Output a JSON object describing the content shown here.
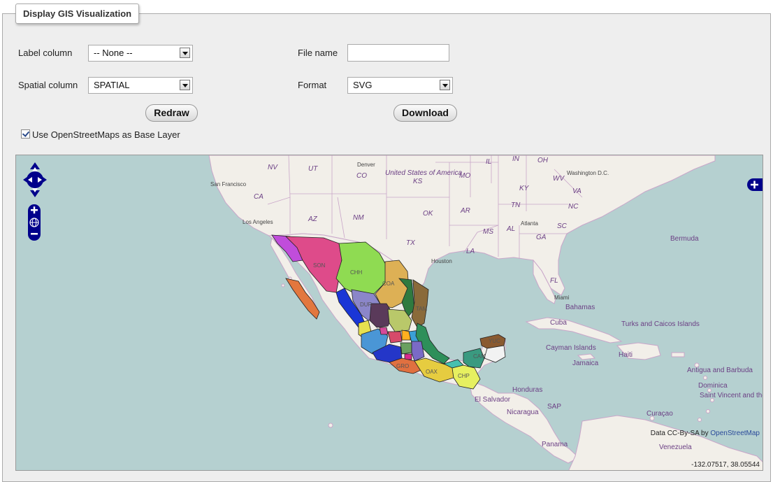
{
  "panel": {
    "title": "Display GIS Visualization"
  },
  "form": {
    "label_column": {
      "label": "Label column",
      "value": "-- None --"
    },
    "spatial_column": {
      "label": "Spatial column",
      "value": "SPATIAL"
    },
    "file_name": {
      "label": "File name",
      "value": ""
    },
    "format": {
      "label": "Format",
      "value": "SVG"
    },
    "redraw_label": "Redraw",
    "download_label": "Download",
    "osm_checkbox_label": "Use OpenStreetMaps as Base Layer",
    "osm_checked": true
  },
  "map": {
    "attribution_prefix": "Data CC-By-SA by",
    "attribution_link": "OpenStreetMap",
    "coordinates": "-132.07517, 38.05544",
    "state_labels": {
      "nv": "NV",
      "ut": "UT",
      "co": "CO",
      "ca": "CA",
      "az": "AZ",
      "nm": "NM",
      "ks": "KS",
      "mo": "MO",
      "il": "IL",
      "in": "IN",
      "oh": "OH",
      "wv": "WV",
      "va": "VA",
      "ky": "KY",
      "ok": "OK",
      "ar": "AR",
      "tn": "TN",
      "nc": "NC",
      "sc": "SC",
      "ms": "MS",
      "al": "AL",
      "ga": "GA",
      "la": "LA",
      "tx": "TX",
      "fl": "FL",
      "usa": "United States of America"
    },
    "city_labels": {
      "san_francisco": "San Francisco",
      "los_angeles": "Los Angeles",
      "denver": "Denver",
      "washington": "Washington D.C.",
      "atlanta": "Atlanta",
      "houston": "Houston",
      "miami": "Miami"
    },
    "place_labels": {
      "bermuda": "Bermuda",
      "bahamas": "Bahamas",
      "cuba": "Cuba",
      "turks": "Turks and Caicos Islands",
      "cayman": "Cayman Islands",
      "haiti": "Haiti",
      "jamaica": "Jamaica",
      "antigua": "Antigua and Barbuda",
      "dominica": "Dominica",
      "vincent": "Saint Vincent and the Grenadines",
      "curacao": "Curaçao",
      "honduras": "Honduras",
      "nicaragua": "Nicaragua",
      "el_salvador": "El Salvador",
      "panama": "Panama",
      "venezuela": "Venezuela",
      "sap": "SAP"
    },
    "mx_labels": {
      "son": "SON",
      "chh": "CHH",
      "coa": "COA",
      "dur": "DUR",
      "tam": "TAM",
      "cam": "CAM",
      "oax": "OAX",
      "chp": "CHP",
      "gro": "GRO",
      "yuc": "YUC"
    },
    "colors": {
      "water": "#b5d0d0",
      "land": "#f2efe9",
      "border": "#c9a6c9"
    }
  }
}
